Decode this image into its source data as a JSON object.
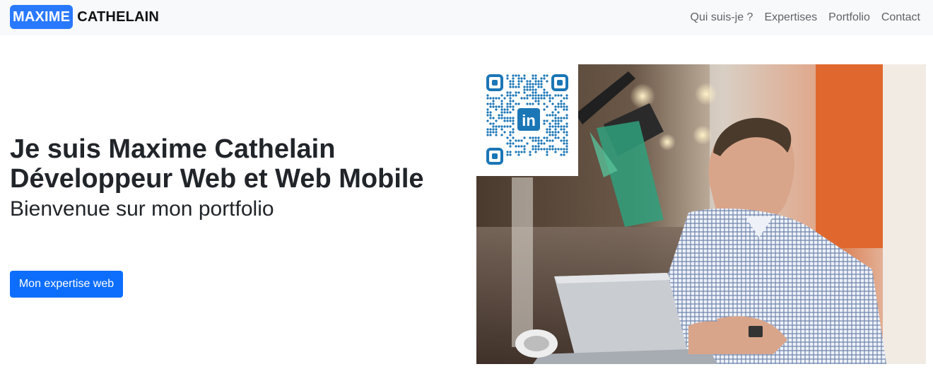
{
  "brand": {
    "first": "MAXIME",
    "last": "CATHELAIN"
  },
  "nav": {
    "items": [
      "Qui suis-je ?",
      "Expertises",
      "Portfolio",
      "Contact"
    ]
  },
  "hero": {
    "title_line1": "Je suis Maxime Cathelain",
    "title_line2": "Développeur Web et Web Mobile",
    "lead": "Bienvenue sur mon portfolio",
    "cta": "Mon expertise web"
  },
  "qr": {
    "badge": "in"
  },
  "colors": {
    "brand_blue": "#2979ff",
    "button_blue": "#0d6efd",
    "qr_blue": "#1b76b6",
    "navbar_bg": "#f8f9fa"
  }
}
